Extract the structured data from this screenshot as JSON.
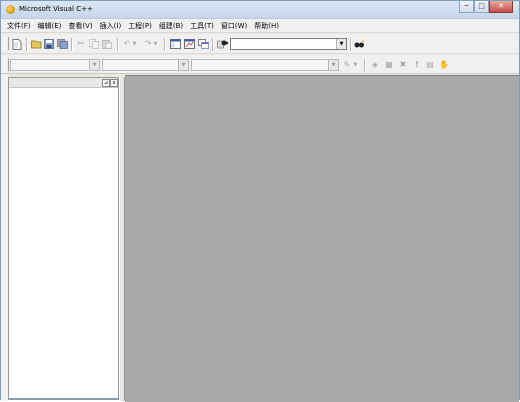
{
  "window": {
    "title": "Microsoft Visual C++"
  },
  "menu": [
    {
      "label": "文件(F)"
    },
    {
      "label": "编辑(E)"
    },
    {
      "label": "查看(V)"
    },
    {
      "label": "插入(I)"
    },
    {
      "label": "工程(P)"
    },
    {
      "label": "组建(B)"
    },
    {
      "label": "工具(T)"
    },
    {
      "label": "窗口(W)"
    },
    {
      "label": "帮助(H)"
    }
  ],
  "toolbar": {
    "find_combo_value": "",
    "icons": [
      "new-text-file-icon",
      "open-folder-icon",
      "save-icon",
      "save-all-icon",
      "cut-icon",
      "copy-icon",
      "paste-icon",
      "undo-icon",
      "redo-icon",
      "workspace-icon",
      "output-icon",
      "windows-list-icon",
      "find-in-files-icon",
      "find-icon"
    ]
  },
  "wizardbar": {
    "class_combo_value": "",
    "filter_combo_value": "",
    "members_combo_value": "",
    "icons": [
      "wizard-action-icon",
      "compile-icon",
      "build-icon",
      "stop-build-icon",
      "execute-icon",
      "go-icon",
      "insert-breakpoint-icon",
      "hand-icon"
    ]
  },
  "glyphs": {
    "minimize": "─",
    "maximize": "□",
    "close": "✕",
    "dropdown": "▼",
    "pin": "⊿",
    "panel_close": "x",
    "execute": "!"
  },
  "colors": {
    "mdi_background": "#a9a9a9",
    "chrome": "#f0f0f0",
    "titlebar": "#c6d6ec"
  }
}
